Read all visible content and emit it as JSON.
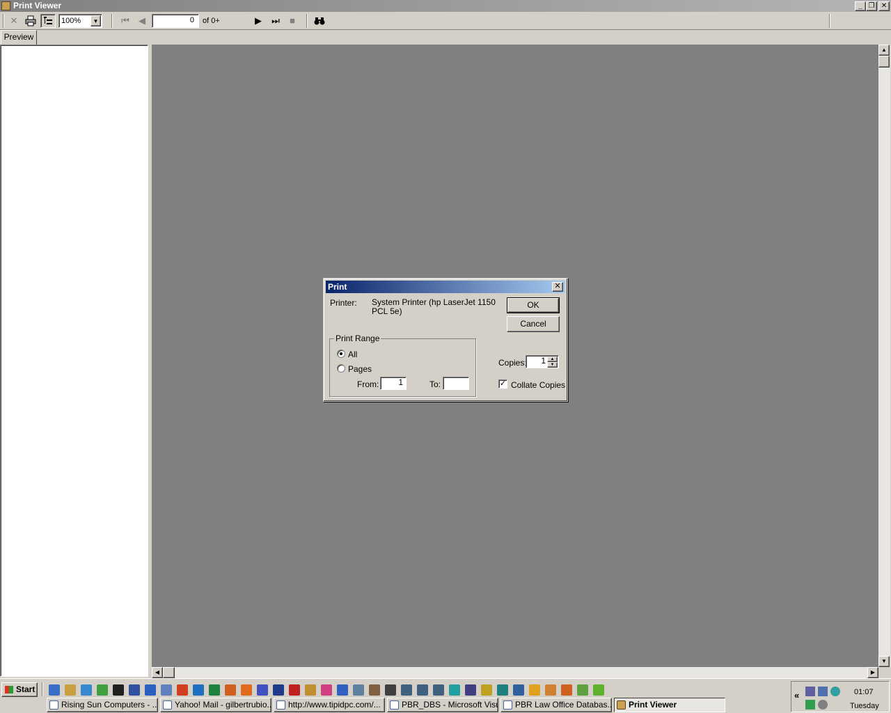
{
  "window": {
    "title": "Print Viewer",
    "caption_buttons": [
      "minimize",
      "restore",
      "close"
    ]
  },
  "toolbar": {
    "zoom": "100%",
    "page_number": "0",
    "page_of": "of 0+",
    "icons": [
      "close-icon",
      "printer-icon",
      "tree-view-icon",
      "first-page-icon",
      "previous-page-icon",
      "next-page-icon",
      "last-page-icon",
      "stop-icon",
      "find-binoculars-icon"
    ]
  },
  "tabs": {
    "preview": "Preview"
  },
  "dialog": {
    "title": "Print",
    "printer_label": "Printer:",
    "printer_value": "System Printer (hp LaserJet 1150 PCL 5e)",
    "ok": "OK",
    "cancel": "Cancel",
    "print_range": "Print Range",
    "all": "All",
    "pages": "Pages",
    "from_label": "From:",
    "from_value": "1",
    "to_label": "To:",
    "to_value": "",
    "copies_label": "Copies:",
    "copies_value": "1",
    "collate": "Collate Copies",
    "selected_range": "All",
    "collate_checked": true
  },
  "taskbar": {
    "start": "Start",
    "tasks": [
      "Rising Sun Computers - ...",
      "Yahoo! Mail - gilbertrubio...",
      "http://www.tipidpc.com/...",
      "PBR_DBS - Microsoft Visu...",
      "PBR Law Office Databas...",
      "Print Viewer"
    ],
    "active_task": "Print Viewer",
    "tray_expand": "«",
    "time": "01:07",
    "day": "Tuesday",
    "quicklaunch_colors": [
      "#3a6fc8",
      "#c8a040",
      "#3a88d0",
      "#40a040",
      "#202020",
      "#3050a0",
      "#2a60c0",
      "#6080c0",
      "#d04020",
      "#1f70c0",
      "#208040",
      "#d06020",
      "#e06a20",
      "#4050c0",
      "#203a8a",
      "#c02020",
      "#c09030",
      "#d04080",
      "#3060c0",
      "#6080a0",
      "#806040",
      "#404040",
      "#406080",
      "#406080",
      "#406080",
      "#20a0a0",
      "#404080",
      "#c0a020",
      "#208080",
      "#3060a0",
      "#e0a020",
      "#d08030",
      "#d06020",
      "#60a040",
      "#60b030"
    ]
  }
}
